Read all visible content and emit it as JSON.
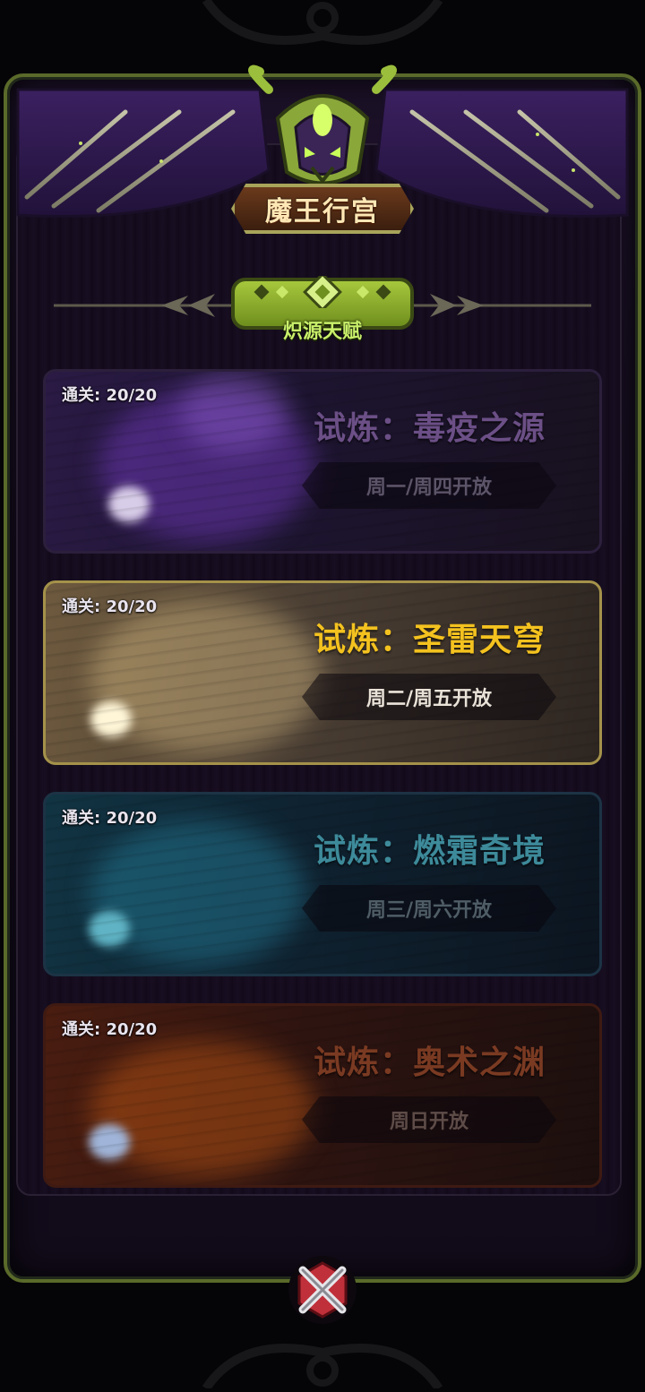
{
  "header": {
    "title": "魔王行宫",
    "subtitle": "炽源天赋"
  },
  "trials": [
    {
      "clear_label": "通关: 20/20",
      "title": "试炼：毒疫之源",
      "schedule": "周一/周四开放",
      "title_color": "#6b4f86",
      "schedule_color": "#5c5468",
      "theme": "poison"
    },
    {
      "clear_label": "通关: 20/20",
      "title": "试炼：圣雷天穹",
      "schedule": "周二/周五开放",
      "title_color": "#f4c21f",
      "schedule_color": "#e8e2d8",
      "theme": "thunder"
    },
    {
      "clear_label": "通关: 20/20",
      "title": "试炼：燃霜奇境",
      "schedule": "周三/周六开放",
      "title_color": "#3d8a9a",
      "schedule_color": "#4f5d66",
      "theme": "frost"
    },
    {
      "clear_label": "通关: 20/20",
      "title": "试炼：奥术之渊",
      "schedule": "周日开放",
      "title_color": "#7a3a22",
      "schedule_color": "#5e4c48",
      "theme": "arcane"
    }
  ],
  "icons": {
    "close": "close-x-icon",
    "emblem": "demon-skull-emblem-icon"
  },
  "colors": {
    "frame_green": "#5a6a2a",
    "accent_green": "#a6c73c",
    "title_text": "#ffe7b5"
  }
}
